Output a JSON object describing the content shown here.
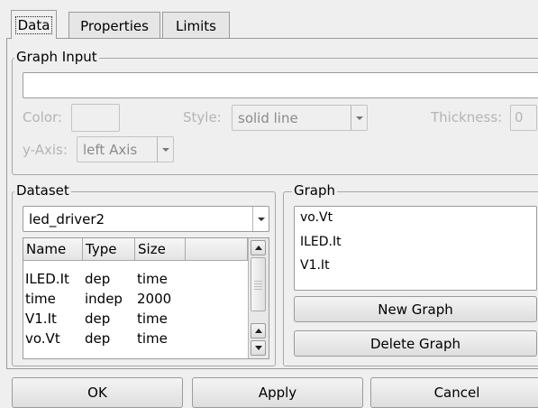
{
  "tabs": [
    {
      "label": "Data",
      "active": true
    },
    {
      "label": "Properties",
      "active": false
    },
    {
      "label": "Limits",
      "active": false
    }
  ],
  "graph_input": {
    "title": "Graph Input",
    "input_value": "",
    "color_label": "Color:",
    "style_label": "Style:",
    "style_value": "solid line",
    "thickness_label": "Thickness:",
    "thickness_value": "0",
    "yaxis_label": "y-Axis:",
    "yaxis_value": "left Axis"
  },
  "dataset": {
    "title": "Dataset",
    "selected": "led_driver2",
    "columns": [
      "Name",
      "Type",
      "Size"
    ],
    "rows": [
      [
        "ILED.It",
        "dep",
        "time"
      ],
      [
        "time",
        "indep",
        "2000"
      ],
      [
        "V1.It",
        "dep",
        "time"
      ],
      [
        "vo.Vt",
        "dep",
        "time"
      ]
    ]
  },
  "graph": {
    "title": "Graph",
    "items": [
      "vo.Vt",
      "ILED.It",
      "V1.It"
    ],
    "new_label": "New Graph",
    "delete_label": "Delete Graph"
  },
  "footer": {
    "ok_label": "OK",
    "apply_label": "Apply",
    "cancel_label": "Cancel"
  }
}
